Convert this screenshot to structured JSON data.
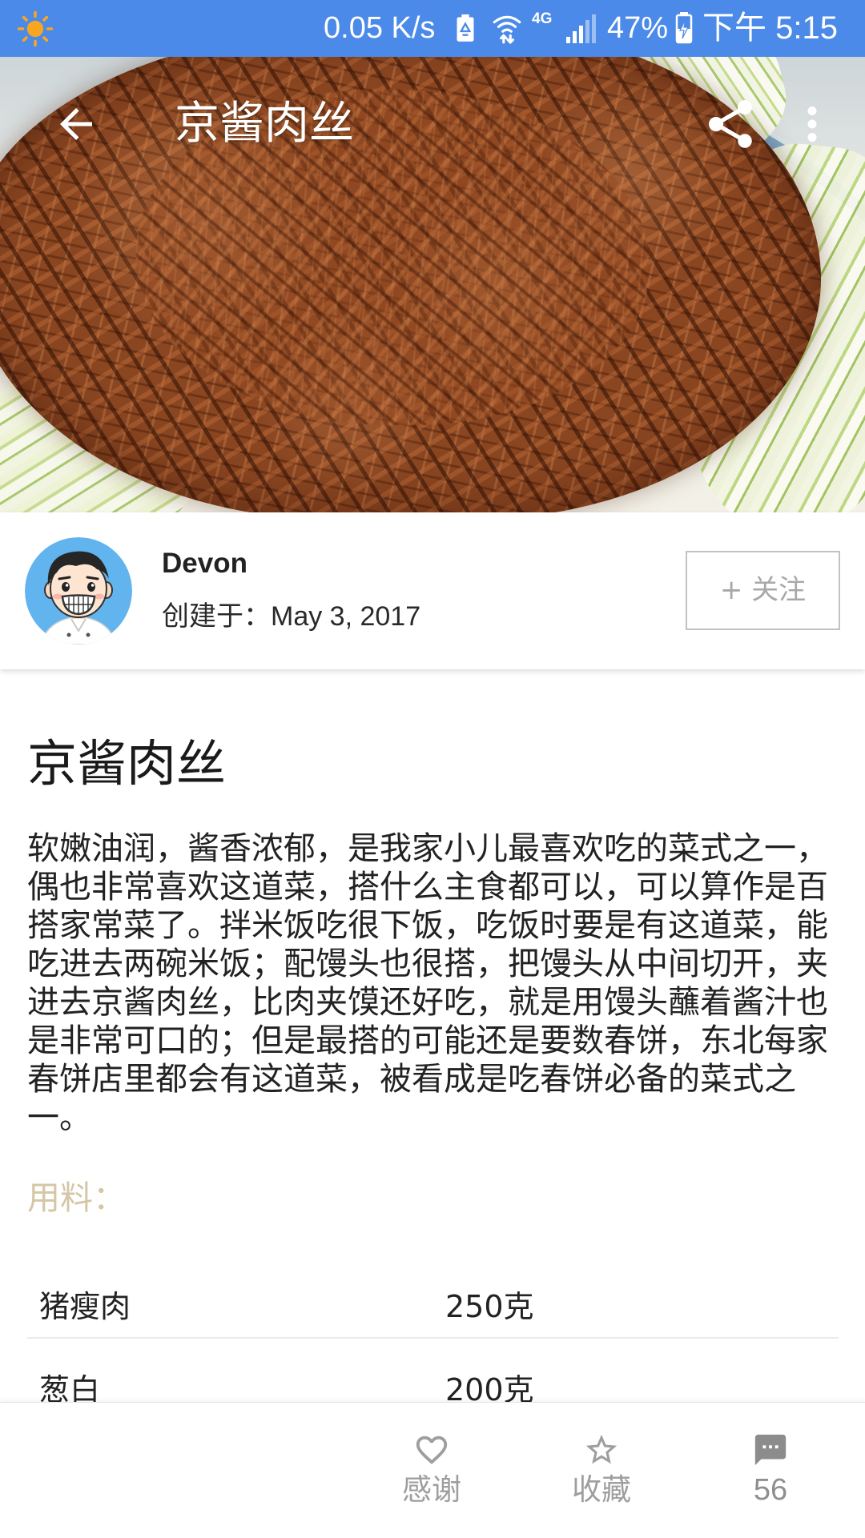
{
  "status_bar": {
    "net_speed": "0.05 K/s",
    "network_type": "4G",
    "battery_percent": "47%",
    "time": "下午 5:15"
  },
  "toolbar": {
    "title": "京酱肉丝"
  },
  "author": {
    "name": "Devon",
    "created_label": "创建于：",
    "created_date": "May 3, 2017",
    "follow_label": "+ 关注"
  },
  "recipe": {
    "title": "京酱肉丝",
    "description": "软嫩油润，酱香浓郁，是我家小儿最喜欢吃的菜式之一，偶也非常喜欢这道菜，搭什么主食都可以，可以算作是百搭家常菜了。拌米饭吃很下饭，吃饭时要是有这道菜，能吃进去两碗米饭；配馒头也很搭，把馒头从中间切开，夹进去京酱肉丝，比肉夹馍还好吃，就是用馒头蘸着酱汁也是非常可口的；但是最搭的可能还是要数春饼，东北每家春饼店里都会有这道菜，被看成是吃春饼必备的菜式之一。",
    "ingredients_heading": "用料：",
    "ingredients": [
      {
        "name": "猪瘦肉",
        "amount": "250克"
      },
      {
        "name": "葱白",
        "amount": "200克"
      }
    ]
  },
  "bottom_bar": {
    "thanks_label": "感谢",
    "favorite_label": "收藏",
    "comments_count": "56"
  },
  "icons": {
    "weather": "sun-icon",
    "battery_saver": "battery-saver-icon",
    "wifi": "wifi-icon",
    "signal": "signal-icon",
    "battery": "battery-charging-icon",
    "back": "arrow-back-icon",
    "share": "share-icon",
    "more": "more-vert-icon",
    "thanks": "heart-outline-icon",
    "favorite": "star-outline-icon",
    "comments": "comment-icon"
  },
  "colors": {
    "status_bar": "#4b8ae8",
    "accent_tan": "#d5c6a6",
    "muted": "#9e9e9e",
    "text": "#1f1f1f"
  }
}
